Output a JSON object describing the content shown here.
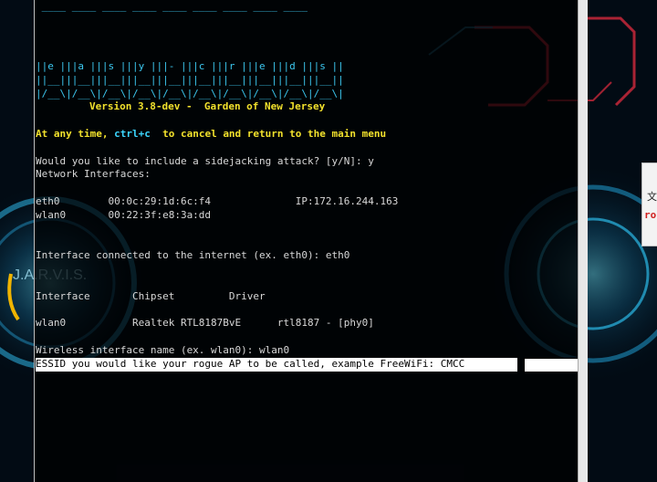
{
  "terminal": {
    "banner_top": " ____ ____ ____ ____ ____ ____ ____ ____ ____",
    "banner_letters": "||e |||a |||s |||y |||- |||c |||r |||e |||d |||s ||",
    "banner_mid": "||__|||__|||__|||__|||__|||__|||__|||__|||__|||__||",
    "banner_bottom": "|/__\\|/__\\|/__\\|/__\\|/__\\|/__\\|/__\\|/__\\|/__\\|/__\\|",
    "version": "Version 3.8-dev -  Garden of New Jersey",
    "cancel_prefix": "At any time, ",
    "cancel_key": "ctrl+c",
    "cancel_suffix": "  to cancel and return to the main menu",
    "sidejack_prompt": "Would you like to include a sidejacking attack? [y/N]: y",
    "net_header": "Network Interfaces:",
    "iface1": "eth0        00:0c:29:1d:6c:f4              IP:172.16.244.163",
    "iface2": "wlan0       00:22:3f:e8:3a:dd",
    "internet_prompt": "Interface connected to the internet (ex. eth0): eth0",
    "table_header": "Interface       Chipset         Driver",
    "table_row": "wlan0           Realtek RTL8187BvE      rtl8187 - [phy0]",
    "wireless_prompt": "Wireless interface name (ex. wlan0): wlan0",
    "essid_prompt": "ESSID you would like your rogue AP to be called, example FreeWiFi: CMCC"
  },
  "wallpaper": {
    "brand": "J.A.R.V.I.S."
  },
  "side_window": {
    "glyph": "文",
    "text": "ro"
  }
}
